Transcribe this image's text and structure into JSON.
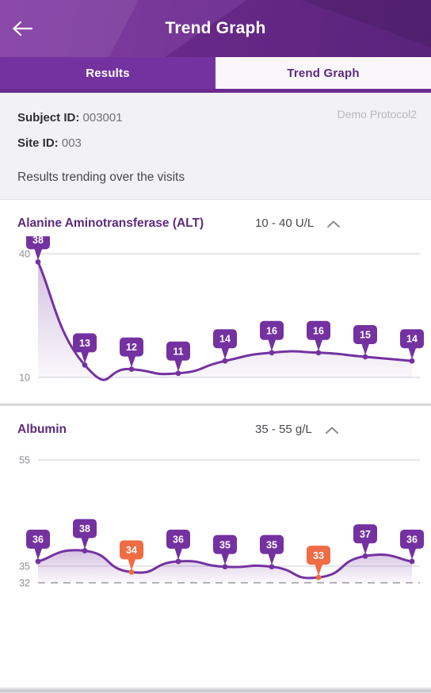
{
  "header": {
    "title": "Trend Graph",
    "back_icon": "arrow-left-icon",
    "accent_color": "#6b2a8e"
  },
  "tabs": [
    {
      "label": "Results",
      "active": true
    },
    {
      "label": "Trend Graph",
      "active": false
    }
  ],
  "info": {
    "subject_label": "Subject ID:",
    "subject_value": "003001",
    "site_label": "Site ID:",
    "site_value": "003",
    "protocol": "Demo Protocol2",
    "subtitle": "Results trending over the visits"
  },
  "colors": {
    "purple": "#7432a0",
    "purple_dark": "#5d2b7e",
    "orange": "#ef6c45",
    "grid": "#cfcfd6",
    "axis_label": "#8d8d96"
  },
  "charts": [
    {
      "title": "Alanine Aminotransferase (ALT)",
      "range": "10 - 40 U/L",
      "collapse_icon": "chevron-up-icon",
      "chart_data": {
        "type": "line",
        "title": "Alanine Aminotransferase (ALT)",
        "xlabel": "",
        "ylabel": "U/L",
        "unit": "U/L",
        "reference_low": 10,
        "reference_high": 40,
        "gridlines": [
          40,
          10
        ],
        "ytick_labels": [
          "40",
          "10"
        ],
        "ylim": [
          10,
          40
        ],
        "grid": true,
        "legend": "none",
        "x": [
          1,
          2,
          3,
          4,
          5,
          6,
          7,
          8,
          9
        ],
        "values": [
          38,
          13,
          12,
          11,
          14,
          16,
          16,
          15,
          14
        ],
        "point_status": [
          "normal",
          "normal",
          "normal",
          "normal",
          "normal",
          "normal",
          "normal",
          "normal",
          "normal"
        ],
        "data_labels": [
          "38",
          "13",
          "12",
          "11",
          "14",
          "16",
          "16",
          "15",
          "14"
        ]
      }
    },
    {
      "title": "Albumin",
      "range": "35 - 55 g/L",
      "collapse_icon": "chevron-up-icon",
      "chart_data": {
        "type": "line",
        "title": "Albumin",
        "xlabel": "",
        "ylabel": "g/L",
        "unit": "g/L",
        "reference_low": 35,
        "reference_high": 55,
        "gridlines": [
          55,
          35,
          32
        ],
        "ytick_labels": [
          "55",
          "35",
          "32"
        ],
        "ylim": [
          32,
          55
        ],
        "grid": true,
        "legend": "none",
        "x": [
          1,
          2,
          3,
          4,
          5,
          6,
          7,
          8,
          9
        ],
        "values": [
          36,
          38,
          34,
          36,
          35,
          35,
          33,
          37,
          36
        ],
        "point_status": [
          "normal",
          "normal",
          "low",
          "normal",
          "normal",
          "normal",
          "low",
          "normal",
          "normal"
        ],
        "data_labels": [
          "36",
          "38",
          "34",
          "36",
          "35",
          "35",
          "33",
          "37",
          "36"
        ]
      }
    }
  ]
}
